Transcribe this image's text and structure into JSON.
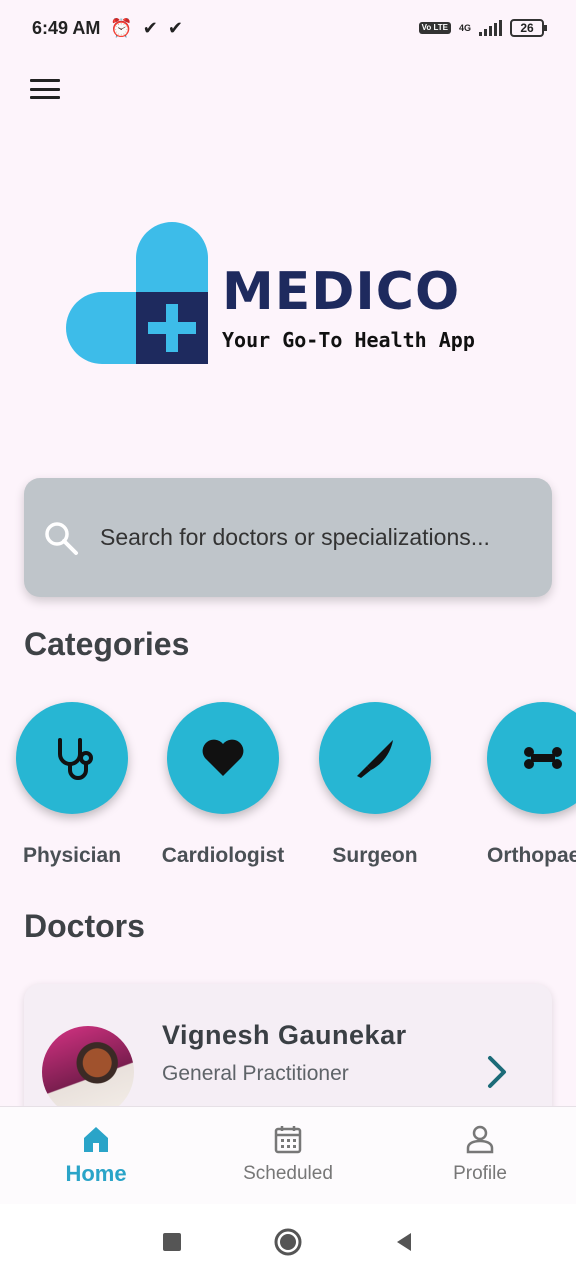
{
  "status_bar": {
    "time": "6:49 AM",
    "network": "4G",
    "volte": "Vo LTE",
    "battery": "26"
  },
  "logo": {
    "word": "MEDICO",
    "tagline": "Your Go-To Health App",
    "colors": {
      "light": "#3dbce9",
      "dark": "#1e2a5e"
    }
  },
  "search": {
    "placeholder": "Search for doctors or specializations..."
  },
  "categories": {
    "title": "Categories",
    "items": [
      {
        "label": "Physician",
        "icon": "stethoscope-icon"
      },
      {
        "label": "Cardiologist",
        "icon": "heart-icon"
      },
      {
        "label": "Surgeon",
        "icon": "scalpel-icon"
      },
      {
        "label": "Orthopaedi",
        "icon": "bone-icon"
      }
    ]
  },
  "doctors": {
    "title": "Doctors",
    "items": [
      {
        "name": "Vignesh Gaunekar",
        "specialization": "General Practitioner"
      }
    ]
  },
  "bottom_nav": {
    "items": [
      {
        "label": "Home",
        "icon": "home-icon",
        "active": true
      },
      {
        "label": "Scheduled",
        "icon": "calendar-icon",
        "active": false
      },
      {
        "label": "Profile",
        "icon": "person-icon",
        "active": false
      }
    ]
  },
  "colors": {
    "accent": "#27b6d3",
    "background": "#fdf4fb",
    "search_bg": "#bfc5ca"
  }
}
